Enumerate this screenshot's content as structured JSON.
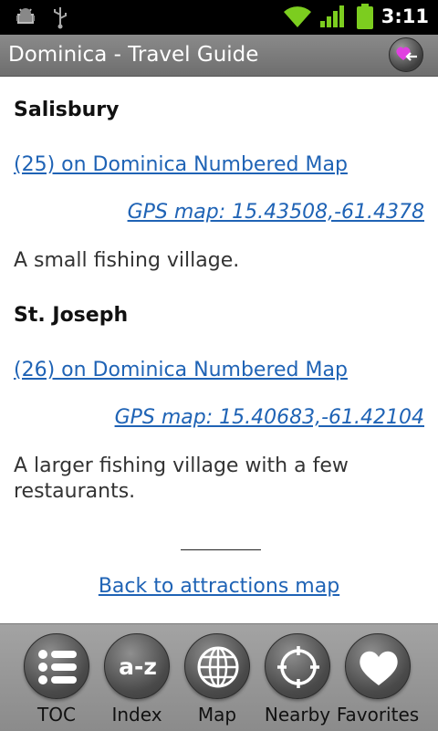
{
  "status_bar": {
    "time": "3:11"
  },
  "app_bar": {
    "title": "Dominica - Travel Guide"
  },
  "entries": [
    {
      "name": "Salisbury",
      "map_link": "(25) on Dominica Numbered Map",
      "gps": "GPS map: 15.43508,-61.4378",
      "description": "A small fishing village."
    },
    {
      "name": "St. Joseph",
      "map_link": "(26) on Dominica Numbered Map",
      "gps": "GPS map: 15.40683,-61.42104",
      "description": "A larger fishing village with a few restaurants."
    }
  ],
  "back_link": "Back to attractions map",
  "toolbar": {
    "buttons": [
      {
        "label": "TOC",
        "icon": "list-icon"
      },
      {
        "label": "Index",
        "icon": "a-z-icon"
      },
      {
        "label": "Map",
        "icon": "globe-icon"
      },
      {
        "label": "Nearby",
        "icon": "crosshair-icon"
      },
      {
        "label": "Favorites",
        "icon": "heart-icon"
      }
    ]
  },
  "colors": {
    "link": "#1f63b5",
    "title_bar": "#7b7b7b",
    "toolbar": "#969696"
  }
}
